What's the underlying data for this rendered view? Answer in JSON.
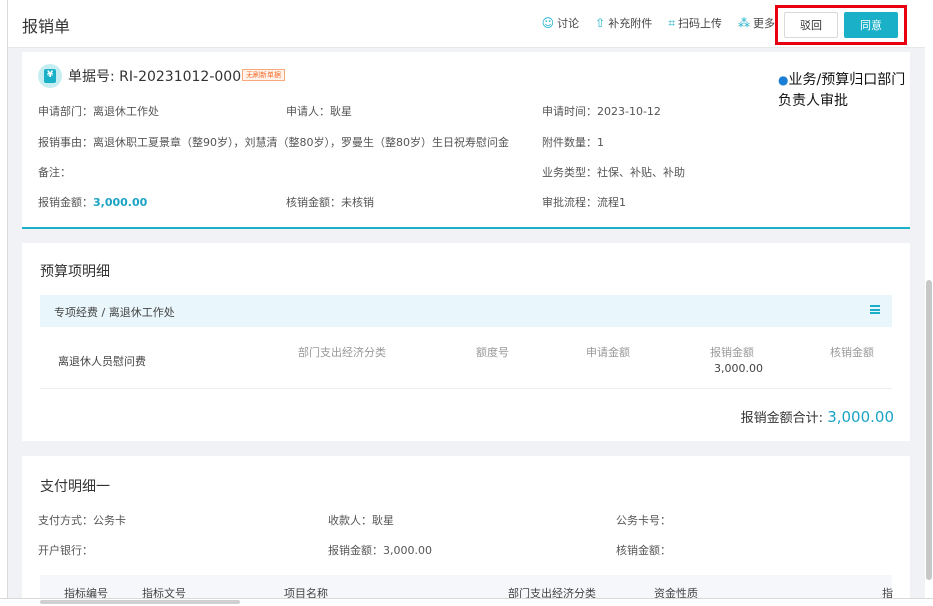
{
  "header": {
    "title": "报销单",
    "actions": [
      {
        "icon": "chat-icon",
        "glyph": "☺",
        "label": "讨论"
      },
      {
        "icon": "upload-icon",
        "glyph": "⇧",
        "label": "补充附件"
      },
      {
        "icon": "scan-icon",
        "glyph": "⌗",
        "label": "扫码上传"
      },
      {
        "icon": "more-icon",
        "glyph": "⁂",
        "label": "更多"
      }
    ],
    "reject_label": "驳回",
    "approve_label": "同意"
  },
  "info": {
    "doc_number": "单据号: RI-20231012-0005",
    "doc_tag": "无刷新单据",
    "annotation": "业务/预算归口部门负责人审批",
    "apply_dept": "申请部门：离退休工作处",
    "applicant": "申请人：耿星",
    "apply_time": "申请时间：2023-10-12",
    "reason": "报销事由：离退休职工夏景章（整90岁），刘慧清（整80岁），罗曼生（整80岁）生日祝寿慰问金",
    "attachments": "附件数量：1",
    "remark": "备注：",
    "biz_type": "业务类型：社保、补贴、补助",
    "amount_label": "报销金额：",
    "amount_value": "3,000.00",
    "writeoff": "核销金额：未核销",
    "flow": "审批流程：流程1"
  },
  "budget": {
    "title": "预算项明细",
    "strip": "专项经费  /  离退休工作处",
    "item_name": "离退休人员慰问费",
    "col_class": "部门支出经济分类",
    "col_quota": "额度号",
    "col_apply": "申请金额",
    "col_reimb": "报销金额",
    "reimb_value": "3,000.00",
    "col_writeoff": "核销金额",
    "total_label": "报销金额合计:",
    "total_value": "3,000.00"
  },
  "payment": {
    "title": "支付明细一",
    "method": "支付方式：公务卡",
    "payee": "收款人：耿星",
    "card_no": "公务卡号：",
    "bank": "开户银行：",
    "amount": "报销金额：3,000.00",
    "writeoff": "核销金额：",
    "table_headers": [
      "指标编号",
      "指标文号",
      "项目名称",
      "部门支出经济分类",
      "资金性质",
      "指"
    ]
  }
}
